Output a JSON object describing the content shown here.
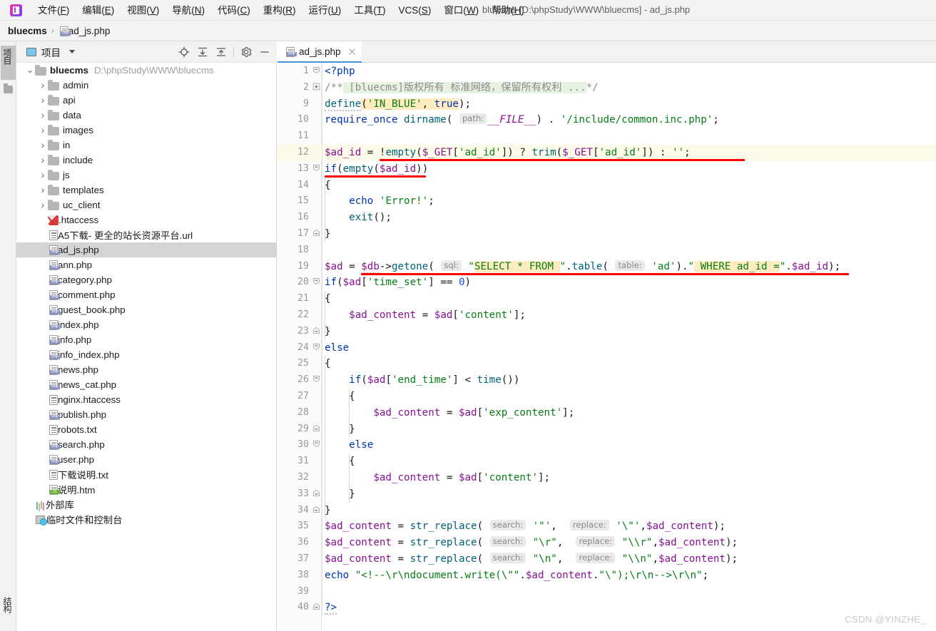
{
  "window": {
    "title": "bluecms [D:\\phpStudy\\WWW\\bluecms] - ad_js.php",
    "app_icon": "phpstorm-logo-icon"
  },
  "menubar": {
    "items": [
      {
        "label": "文件",
        "mnemonic": "F"
      },
      {
        "label": "编辑",
        "mnemonic": "E"
      },
      {
        "label": "视图",
        "mnemonic": "V"
      },
      {
        "label": "导航",
        "mnemonic": "N"
      },
      {
        "label": "代码",
        "mnemonic": "C"
      },
      {
        "label": "重构",
        "mnemonic": "R"
      },
      {
        "label": "运行",
        "mnemonic": "U"
      },
      {
        "label": "工具",
        "mnemonic": "T"
      },
      {
        "label": "VCS",
        "mnemonic": "S"
      },
      {
        "label": "窗口",
        "mnemonic": "W"
      },
      {
        "label": "帮助",
        "mnemonic": "H"
      }
    ]
  },
  "breadcrumb": {
    "root": "bluecms",
    "separator": "›",
    "file": "ad_js.php"
  },
  "toolstrip": {
    "project_tab": "项目",
    "structure_tab": "结构"
  },
  "project_panel": {
    "title": "项目",
    "actions": [
      {
        "name": "locate-icon",
        "label": "定位"
      },
      {
        "name": "expand-all-icon",
        "label": "全部展开"
      },
      {
        "name": "collapse-all-icon",
        "label": "全部折叠"
      },
      {
        "name": "settings-gear-icon",
        "label": "设置"
      },
      {
        "name": "hide-icon",
        "label": "隐藏"
      }
    ],
    "tree": [
      {
        "label": "bluecms",
        "path": "D:\\phpStudy\\WWW\\bluecms",
        "icon": "folder",
        "depth": 0,
        "arrow": "expanded",
        "bold": true
      },
      {
        "label": "admin",
        "icon": "folder",
        "depth": 1,
        "arrow": "collapsed"
      },
      {
        "label": "api",
        "icon": "folder",
        "depth": 1,
        "arrow": "collapsed"
      },
      {
        "label": "data",
        "icon": "folder",
        "depth": 1,
        "arrow": "collapsed"
      },
      {
        "label": "images",
        "icon": "folder",
        "depth": 1,
        "arrow": "collapsed"
      },
      {
        "label": "in",
        "icon": "folder",
        "depth": 1,
        "arrow": "collapsed"
      },
      {
        "label": "include",
        "icon": "folder",
        "depth": 1,
        "arrow": "collapsed"
      },
      {
        "label": "js",
        "icon": "folder",
        "depth": 1,
        "arrow": "collapsed"
      },
      {
        "label": "templates",
        "icon": "folder",
        "depth": 1,
        "arrow": "collapsed"
      },
      {
        "label": "uc_client",
        "icon": "folder",
        "depth": 1,
        "arrow": "collapsed"
      },
      {
        "label": ".htaccess",
        "icon": "pencil",
        "depth": 1,
        "arrow": "none"
      },
      {
        "label": "A5下载- 更全的站长资源平台.url",
        "icon": "page",
        "depth": 1,
        "arrow": "none"
      },
      {
        "label": "ad_js.php",
        "icon": "php",
        "depth": 1,
        "arrow": "none",
        "selected": true
      },
      {
        "label": "ann.php",
        "icon": "php",
        "depth": 1,
        "arrow": "none"
      },
      {
        "label": "category.php",
        "icon": "php",
        "depth": 1,
        "arrow": "none"
      },
      {
        "label": "comment.php",
        "icon": "php",
        "depth": 1,
        "arrow": "none"
      },
      {
        "label": "guest_book.php",
        "icon": "php",
        "depth": 1,
        "arrow": "none"
      },
      {
        "label": "index.php",
        "icon": "php",
        "depth": 1,
        "arrow": "none"
      },
      {
        "label": "info.php",
        "icon": "php",
        "depth": 1,
        "arrow": "none"
      },
      {
        "label": "info_index.php",
        "icon": "php",
        "depth": 1,
        "arrow": "none"
      },
      {
        "label": "news.php",
        "icon": "php",
        "depth": 1,
        "arrow": "none"
      },
      {
        "label": "news_cat.php",
        "icon": "php",
        "depth": 1,
        "arrow": "none"
      },
      {
        "label": "nginx.htaccess",
        "icon": "page",
        "depth": 1,
        "arrow": "none"
      },
      {
        "label": "publish.php",
        "icon": "php",
        "depth": 1,
        "arrow": "none"
      },
      {
        "label": "robots.txt",
        "icon": "page",
        "depth": 1,
        "arrow": "none"
      },
      {
        "label": "search.php",
        "icon": "php",
        "depth": 1,
        "arrow": "none"
      },
      {
        "label": "user.php",
        "icon": "php",
        "depth": 1,
        "arrow": "none"
      },
      {
        "label": "下载说明.txt",
        "icon": "page",
        "depth": 1,
        "arrow": "none"
      },
      {
        "label": "说明.htm",
        "icon": "htm",
        "depth": 1,
        "arrow": "none"
      },
      {
        "label": "外部库",
        "icon": "lib",
        "depth": 0,
        "arrow": "none"
      },
      {
        "label": "临时文件和控制台",
        "icon": "console",
        "depth": 0,
        "arrow": "none"
      }
    ]
  },
  "editor": {
    "tab": {
      "label": "ad_js.php",
      "icon": "php-file-icon",
      "close": "×"
    },
    "lines": [
      {
        "n": "1",
        "fold": "minus"
      },
      {
        "n": "2",
        "fold": "plus"
      },
      {
        "n": "9"
      },
      {
        "n": "10"
      },
      {
        "n": "11"
      },
      {
        "n": "12",
        "highlight": true
      },
      {
        "n": "13",
        "fold": "minus"
      },
      {
        "n": "14"
      },
      {
        "n": "15"
      },
      {
        "n": "16"
      },
      {
        "n": "17",
        "fold": "end"
      },
      {
        "n": "18"
      },
      {
        "n": "19"
      },
      {
        "n": "20",
        "fold": "minus"
      },
      {
        "n": "21"
      },
      {
        "n": "22"
      },
      {
        "n": "23",
        "fold": "end"
      },
      {
        "n": "24",
        "fold": "minus"
      },
      {
        "n": "25"
      },
      {
        "n": "26",
        "fold": "minus"
      },
      {
        "n": "27"
      },
      {
        "n": "28"
      },
      {
        "n": "29",
        "fold": "end"
      },
      {
        "n": "30",
        "fold": "minus"
      },
      {
        "n": "31"
      },
      {
        "n": "32"
      },
      {
        "n": "33",
        "fold": "end"
      },
      {
        "n": "34",
        "fold": "end"
      },
      {
        "n": "35"
      },
      {
        "n": "36"
      },
      {
        "n": "37"
      },
      {
        "n": "38"
      },
      {
        "n": "39"
      },
      {
        "n": "40",
        "fold": "end"
      }
    ],
    "code_text": {
      "l1": "<?php",
      "l2": "/** [bluecms]版权所有 标准网络，保留所有权利 ...*/",
      "l9": "define('IN_BLUE', true);",
      "l10": "require_once dirname( path: __FILE__) . '/include/common.inc.php';",
      "l11": "",
      "l12": "$ad_id = !empty($_GET['ad_id']) ? trim($_GET['ad_id']) : '';",
      "l13": "if(empty($ad_id))",
      "l14": "{",
      "l15": "    echo 'Error!';",
      "l16": "    exit();",
      "l17": "}",
      "l18": "",
      "l19": "$ad = $db->getone( sql: \"SELECT * FROM \".table( table: 'ad').\" WHERE ad_id =\".$ad_id);",
      "l20": "if($ad['time_set'] == 0)",
      "l21": "{",
      "l22": "    $ad_content = $ad['content'];",
      "l23": "}",
      "l24": "else",
      "l25": "{",
      "l26": "    if($ad['end_time'] < time())",
      "l27": "    {",
      "l28": "        $ad_content = $ad['exp_content'];",
      "l29": "    }",
      "l30": "    else",
      "l31": "    {",
      "l32": "        $ad_content = $ad['content'];",
      "l33": "    }",
      "l34": "}",
      "l35": "$ad_content = str_replace( search: '\"',  replace: '\\\"',$ad_content);",
      "l36": "$ad_content = str_replace( search: \"\\r\",  replace: \"\\\\r\",$ad_content);",
      "l37": "$ad_content = str_replace( search: \"\\n\",  replace: \"\\\\n\",$ad_content);",
      "l38": "echo \"<!--\\r\\ndocument.write(\\\"\".$ad_content.\"\\\");\\r\\n-->\\r\\n\";",
      "l39": "",
      "l40": "?>"
    },
    "param_hints": {
      "path": "path:",
      "sql": "sql:",
      "table": "table:",
      "search": "search:",
      "replace": "replace:"
    },
    "annotations": [
      {
        "name": "red-underline-line12",
        "line": "12",
        "note": "SQL injection source highlighted"
      },
      {
        "name": "red-underline-line13",
        "line": "13",
        "note": "empty check highlighted"
      },
      {
        "name": "red-underline-line19",
        "line": "19",
        "note": "vulnerable SQL query highlighted"
      }
    ]
  },
  "watermark": {
    "text": "CSDN @YINZHE_"
  },
  "colors": {
    "accent": "#4a90d9",
    "annotation_red": "#ff0000",
    "keyword": "#0033b3",
    "string": "#067d17",
    "variable": "#871094",
    "comment": "#8c8c8c",
    "function": "#00627a",
    "number": "#1750eb",
    "highlight_row": "#fcfae8",
    "sql_highlight": "#ffecc1",
    "comment_highlight": "#e7f2e0"
  }
}
